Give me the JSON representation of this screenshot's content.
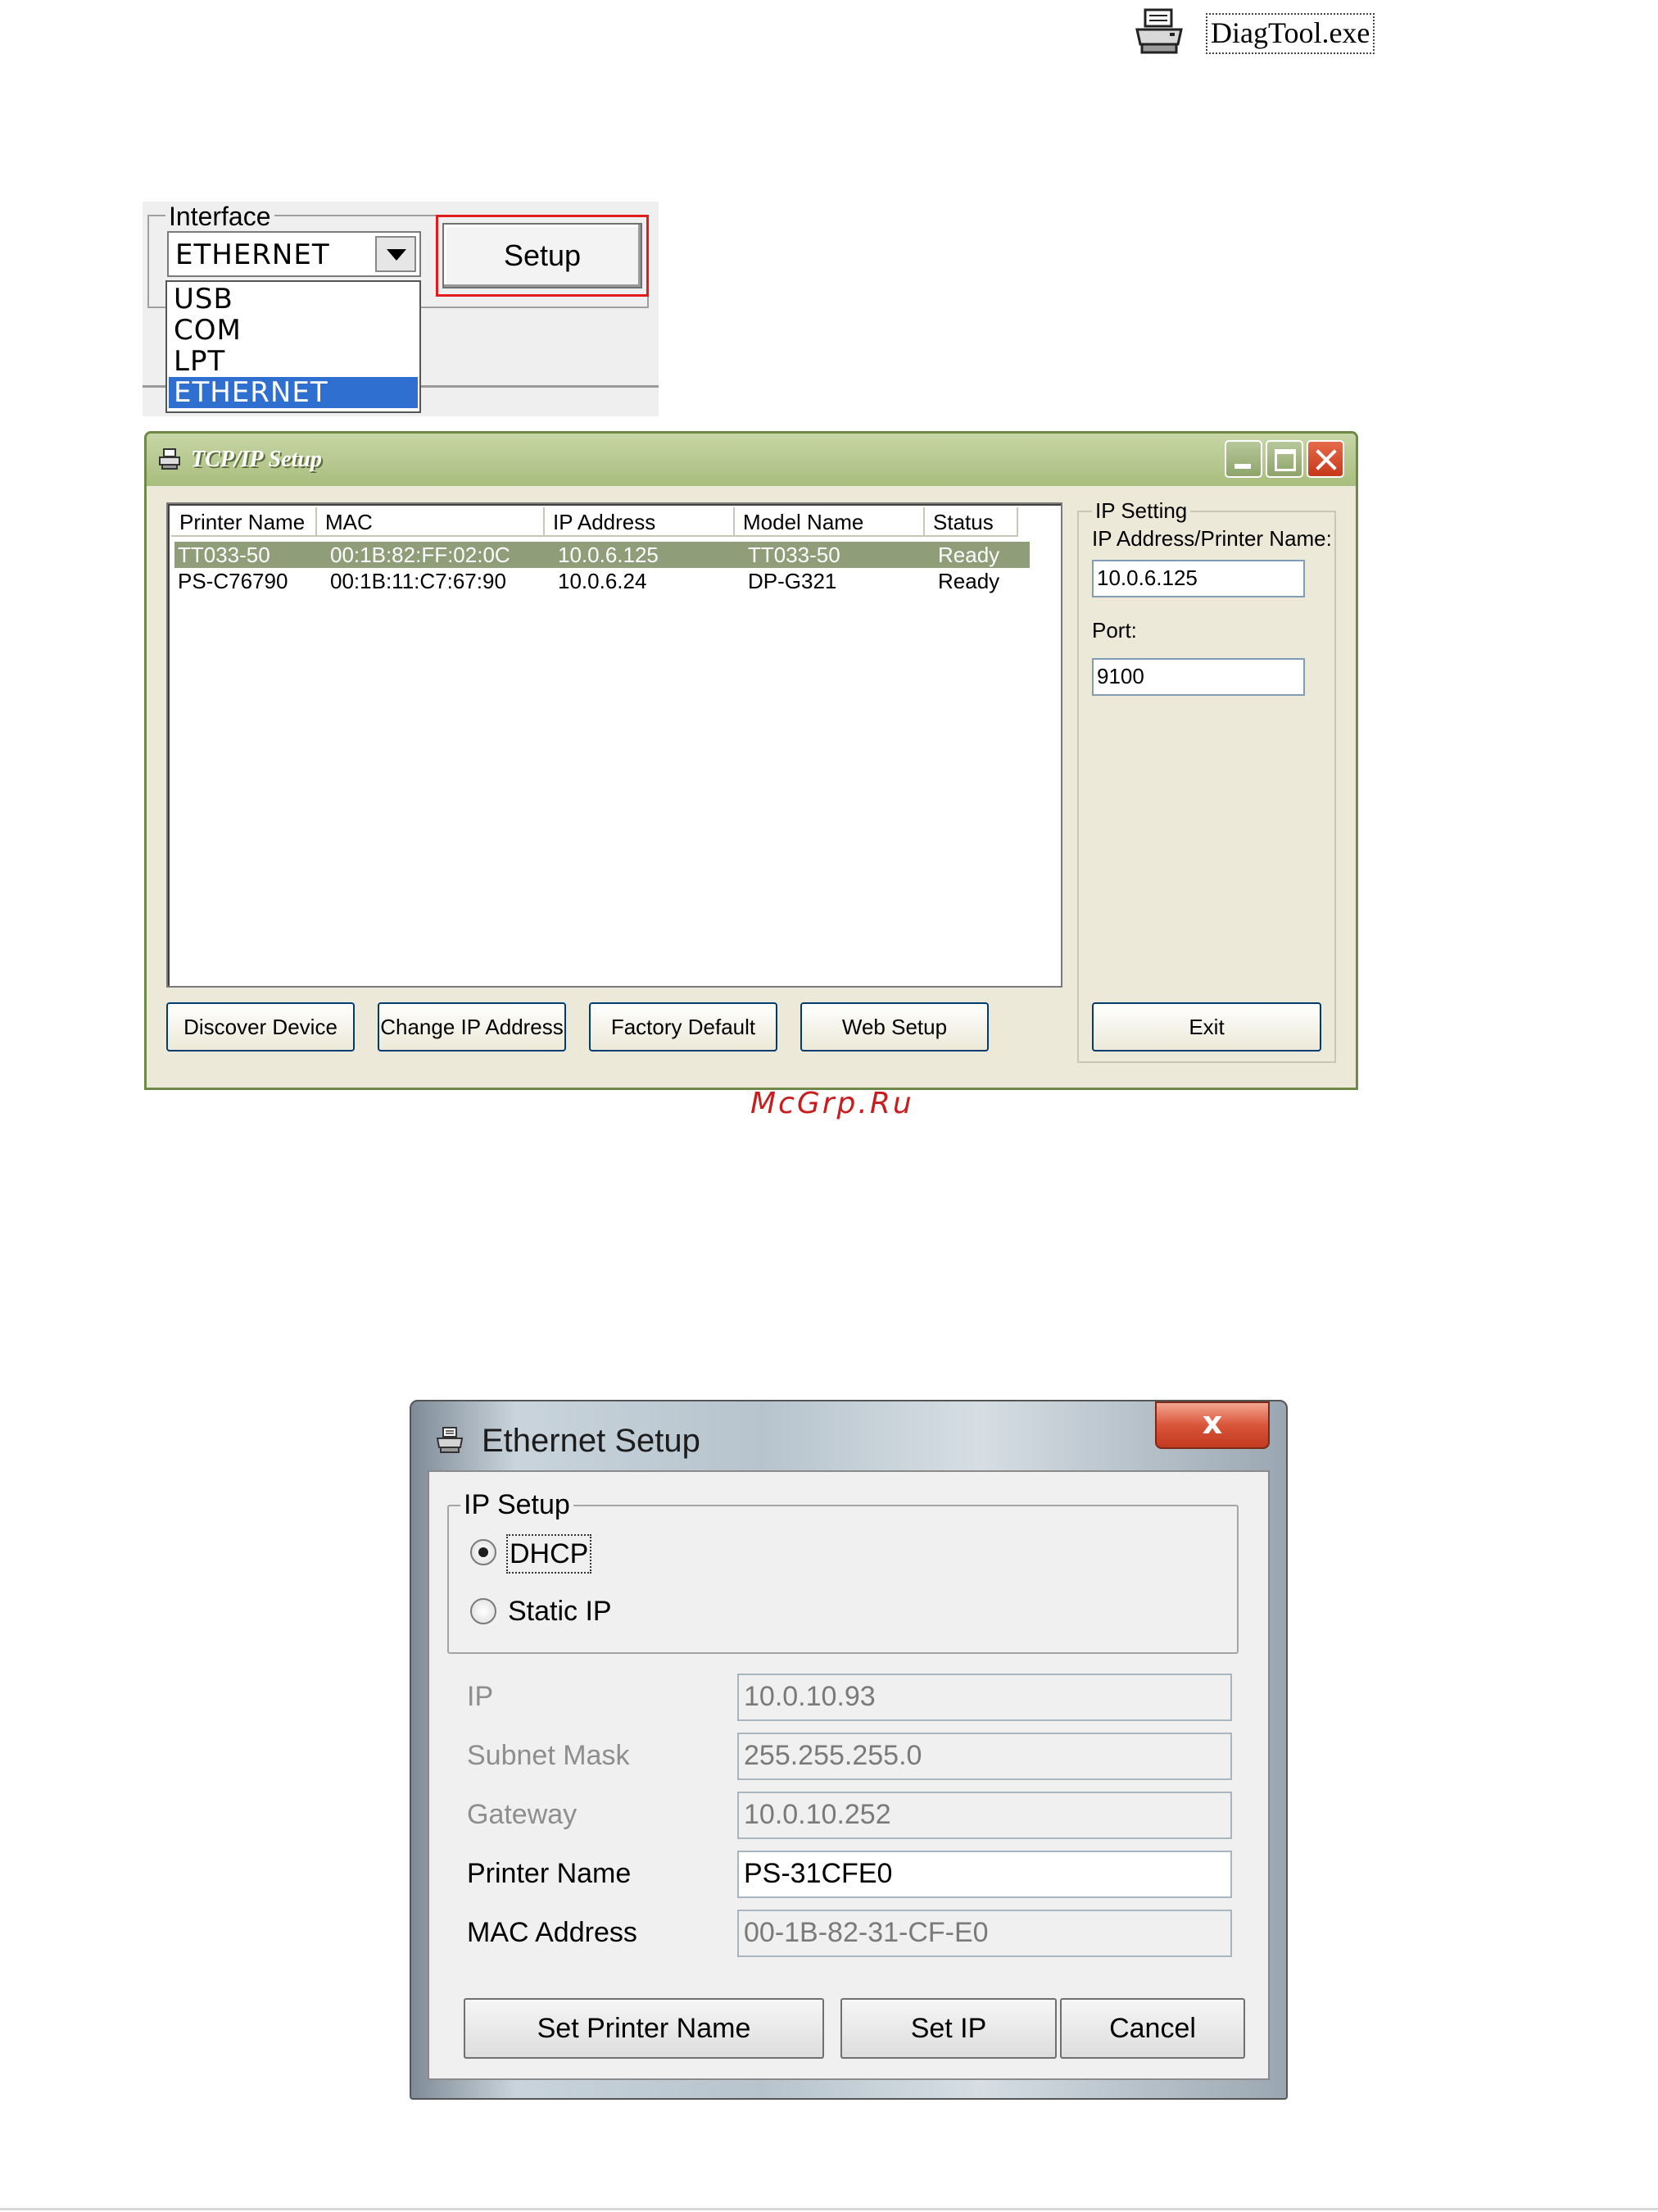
{
  "diagtool": {
    "label": "DiagTool.exe",
    "icon": "printer-icon"
  },
  "interface": {
    "legend": "Interface",
    "selected": "ETHERNET",
    "setup_label": "Setup",
    "options": [
      "USB",
      "COM",
      "LPT",
      "ETHERNET"
    ]
  },
  "tcpip": {
    "title": "TCP/IP Setup",
    "columns": [
      "Printer Name",
      "MAC",
      "IP Address",
      "Model Name",
      "Status"
    ],
    "rows": [
      [
        "TT033-50",
        "00:1B:82:FF:02:0C",
        "10.0.6.125",
        "TT033-50",
        "Ready"
      ],
      [
        "PS-C76790",
        "00:1B:11:C7:67:90",
        "10.0.6.24",
        "DP-G321",
        "Ready"
      ]
    ],
    "ip_setting_legend": "IP Setting",
    "ip_label": "IP Address/Printer Name:",
    "ip_value": "10.0.6.125",
    "port_label": "Port:",
    "port_value": "9100",
    "buttons": {
      "discover": "Discover Device",
      "change_ip": "Change IP Address",
      "factory": "Factory Default",
      "web": "Web Setup",
      "exit": "Exit"
    },
    "colors": {
      "title_bar": "#a8bd7e",
      "selected_row": "#8f9d78",
      "window_bg": "#ece9d8"
    }
  },
  "watermark": "McGrp.Ru",
  "ethernet": {
    "title": "Ethernet Setup",
    "ip_setup_legend": "IP Setup",
    "dhcp_label": "DHCP",
    "static_label": "Static IP",
    "selected_mode": "DHCP",
    "fields": {
      "ip_label": "IP",
      "ip_value": "10.0.10.93",
      "subnet_label": "Subnet Mask",
      "subnet_value": "255.255.255.0",
      "gateway_label": "Gateway",
      "gateway_value": "10.0.10.252",
      "printer_name_label": "Printer Name",
      "printer_name_value": "PS-31CFE0",
      "mac_label": "MAC Address",
      "mac_value": "00-1B-82-31-CF-E0"
    },
    "buttons": {
      "set_name": "Set Printer Name",
      "set_ip": "Set IP",
      "cancel": "Cancel"
    },
    "colors": {
      "close_button": "#d9553a"
    }
  }
}
